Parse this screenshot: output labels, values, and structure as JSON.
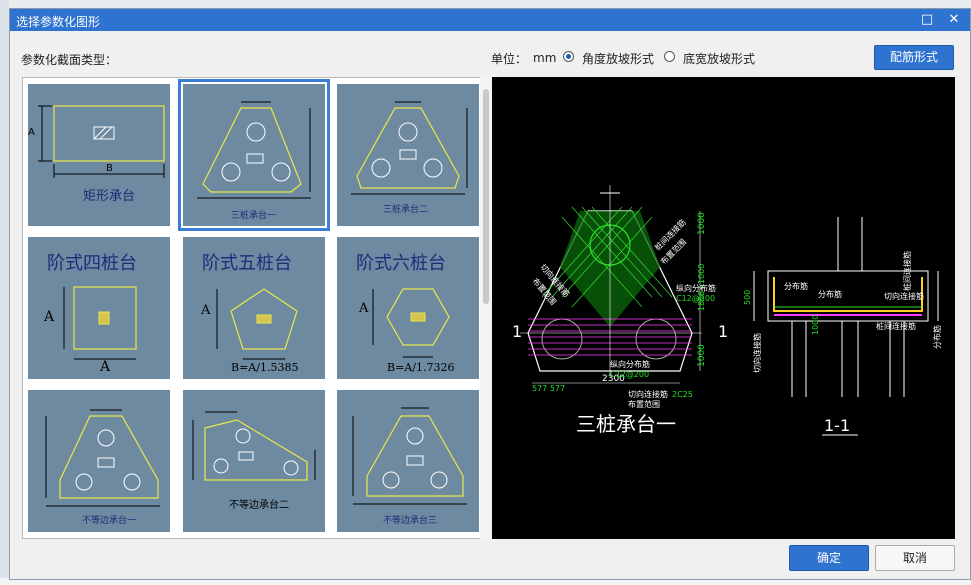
{
  "dialog": {
    "title": "选择参数化图形",
    "minimize_glyph": "□",
    "close_glyph": "✕",
    "section_label": "参数化截面类型：",
    "unit_label": "单位：",
    "unit_value": "mm",
    "radio_angle": "角度放坡形式",
    "radio_width": "底宽放坡形式",
    "rebar_button": "配筋形式",
    "ok_button": "确定",
    "cancel_button": "取消"
  },
  "tiles": {
    "t1": {
      "caption": "矩形承台",
      "a": "A",
      "b": "B"
    },
    "t2": {
      "caption": "三桩承台一"
    },
    "t3": {
      "caption": "三桩承台二"
    },
    "t4": {
      "caption": "阶式四桩台",
      "a": "A",
      "b": "A"
    },
    "t5": {
      "caption": "阶式五桩台",
      "a": "A",
      "b": "B=A/1.5385"
    },
    "t6": {
      "caption": "阶式六桩台",
      "a": "A",
      "b": "B=A/1.7326"
    },
    "t7": {
      "caption": "不等边承台一"
    },
    "t8": {
      "caption": "不等边承台二"
    },
    "t9": {
      "caption": "不等边承台三"
    }
  },
  "preview": {
    "title": "三桩承台一",
    "section_mark": "1-1",
    "cut_mark": "1",
    "dims": {
      "d1": "1000",
      "d2": "1858+1000",
      "d3": "1000",
      "d4": "2300",
      "d5": "577 577",
      "d6": "500",
      "d7": "1000"
    },
    "notes": {
      "n1": "切向连接筋",
      "n2": "布置范围",
      "n3": "桩间连接筋",
      "n4": "布置范围",
      "n5": "纵向分布筋",
      "n6": "C12@200",
      "n7": "纵向分布筋",
      "n8": "C12@200",
      "n9": "切向连接筋",
      "n10": "布置范围",
      "n11": "2C25",
      "n12": "分布筋",
      "n13": "分布筋",
      "n14": "切向连接筋",
      "n15": "桩间连接筋",
      "n16": "切向连接筋",
      "n17": "分布筋",
      "n18": "桩间连接筋"
    }
  }
}
